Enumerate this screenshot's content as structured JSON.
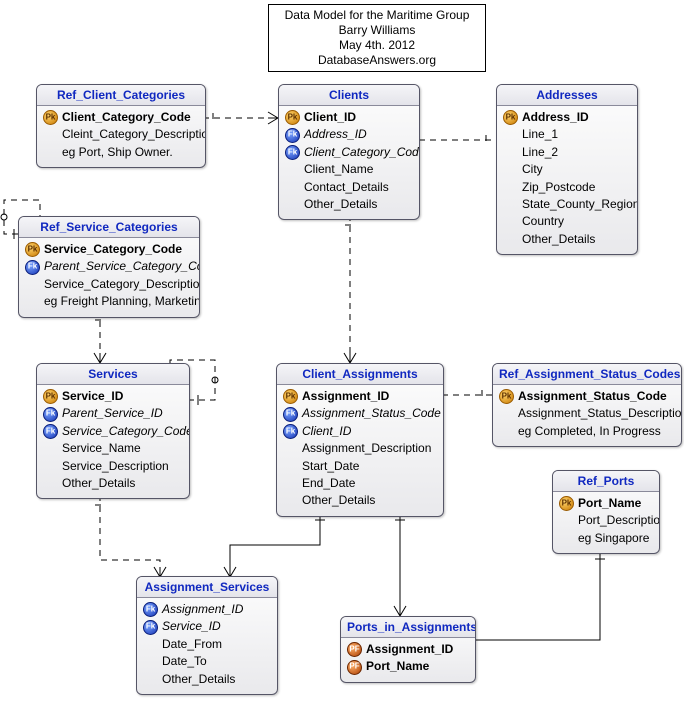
{
  "title_box": {
    "line1": "Data Model for the Maritime Group",
    "line2": "Barry Williams",
    "line3": "May 4th. 2012",
    "line4": "DatabaseAnswers.org"
  },
  "entities": {
    "ref_client_categories": {
      "title": "Ref_Client_Categories",
      "attrs": [
        {
          "key": "pk",
          "text": "Client_Category_Code",
          "bold": true
        },
        {
          "key": "",
          "text": "Cleint_Category_Description"
        },
        {
          "key": "",
          "text": "eg Port, Ship Owner."
        }
      ]
    },
    "clients": {
      "title": "Clients",
      "attrs": [
        {
          "key": "pk",
          "text": "Client_ID",
          "bold": true
        },
        {
          "key": "fk",
          "text": "Address_ID",
          "italic": true
        },
        {
          "key": "fk",
          "text": "Client_Category_Code",
          "italic": true
        },
        {
          "key": "",
          "text": "Client_Name"
        },
        {
          "key": "",
          "text": "Contact_Details"
        },
        {
          "key": "",
          "text": "Other_Details"
        }
      ]
    },
    "addresses": {
      "title": "Addresses",
      "attrs": [
        {
          "key": "pk",
          "text": "Address_ID",
          "bold": true
        },
        {
          "key": "",
          "text": "Line_1"
        },
        {
          "key": "",
          "text": "Line_2"
        },
        {
          "key": "",
          "text": "City"
        },
        {
          "key": "",
          "text": "Zip_Postcode"
        },
        {
          "key": "",
          "text": "State_County_Region"
        },
        {
          "key": "",
          "text": "Country"
        },
        {
          "key": "",
          "text": "Other_Details"
        }
      ]
    },
    "ref_service_categories": {
      "title": "Ref_Service_Categories",
      "attrs": [
        {
          "key": "pk",
          "text": "Service_Category_Code",
          "bold": true
        },
        {
          "key": "fk",
          "text": "Parent_Service_Category_Code",
          "italic": true
        },
        {
          "key": "",
          "text": "Service_Category_Description"
        },
        {
          "key": "",
          "text": "eg Freight Planning, Marketing."
        }
      ]
    },
    "services": {
      "title": "Services",
      "attrs": [
        {
          "key": "pk",
          "text": "Service_ID",
          "bold": true
        },
        {
          "key": "fk",
          "text": "Parent_Service_ID",
          "italic": true
        },
        {
          "key": "fk",
          "text": "Service_Category_Code",
          "italic": true
        },
        {
          "key": "",
          "text": "Service_Name"
        },
        {
          "key": "",
          "text": "Service_Description"
        },
        {
          "key": "",
          "text": "Other_Details"
        }
      ]
    },
    "client_assignments": {
      "title": "Client_Assignments",
      "attrs": [
        {
          "key": "pk",
          "text": "Assignment_ID",
          "bold": true
        },
        {
          "key": "fk",
          "text": "Assignment_Status_Code",
          "italic": true
        },
        {
          "key": "fk",
          "text": "Client_ID",
          "italic": true
        },
        {
          "key": "",
          "text": "Assignment_Description"
        },
        {
          "key": "",
          "text": "Start_Date"
        },
        {
          "key": "",
          "text": "End_Date"
        },
        {
          "key": "",
          "text": "Other_Details"
        }
      ]
    },
    "ref_assignment_status_codes": {
      "title": "Ref_Assignment_Status_Codes",
      "attrs": [
        {
          "key": "pk",
          "text": "Assignment_Status_Code",
          "bold": true
        },
        {
          "key": "",
          "text": "Assignment_Status_Description"
        },
        {
          "key": "",
          "text": "eg Completed, In Progress"
        }
      ]
    },
    "ref_ports": {
      "title": "Ref_Ports",
      "attrs": [
        {
          "key": "pk",
          "text": "Port_Name",
          "bold": true
        },
        {
          "key": "",
          "text": "Port_Description"
        },
        {
          "key": "",
          "text": "eg Singapore"
        }
      ]
    },
    "assignment_services": {
      "title": "Assignment_Services",
      "attrs": [
        {
          "key": "fk",
          "text": "Assignment_ID",
          "italic": true
        },
        {
          "key": "fk",
          "text": "Service_ID",
          "italic": true
        },
        {
          "key": "",
          "text": "Date_From"
        },
        {
          "key": "",
          "text": "Date_To"
        },
        {
          "key": "",
          "text": "Other_Details"
        }
      ]
    },
    "ports_in_assignments": {
      "title": "Ports_in_Assignments",
      "attrs": [
        {
          "key": "pf",
          "text": "Assignment_ID",
          "bold": true
        },
        {
          "key": "pf",
          "text": "Port_Name",
          "bold": true
        }
      ]
    }
  },
  "keys": {
    "pk_label": "Pk",
    "fk_label": "Fk",
    "pf_label": "PF"
  }
}
